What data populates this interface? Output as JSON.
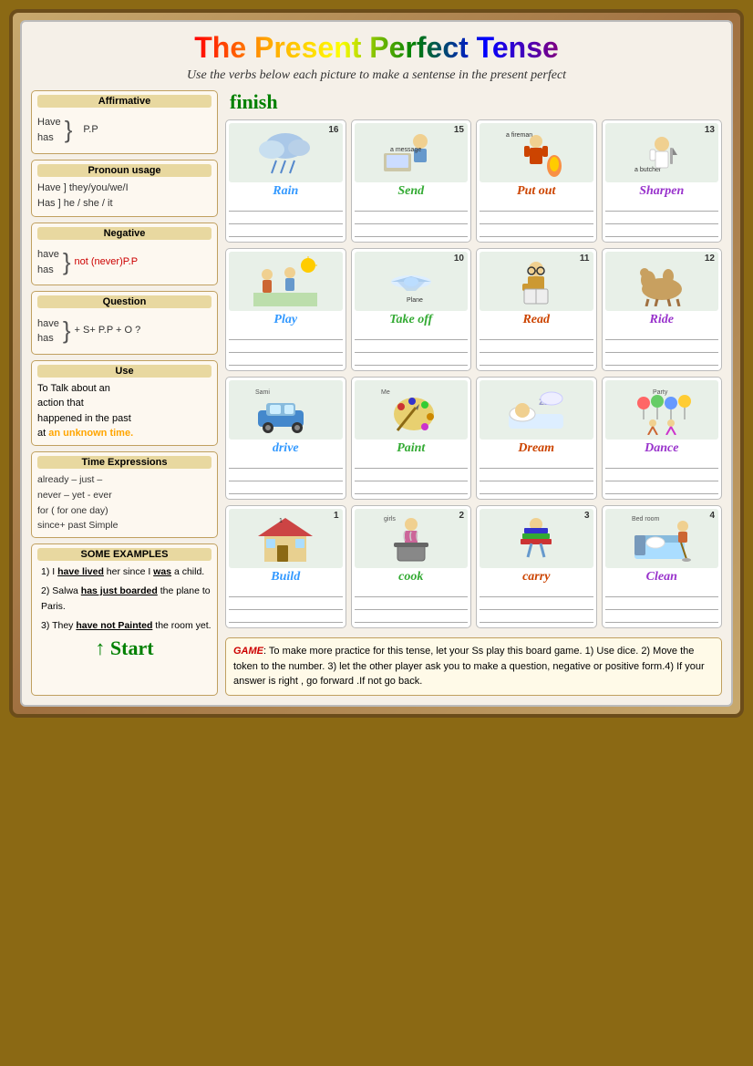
{
  "page": {
    "title": "The Present Perfect Tense",
    "subtitle": "Use the verbs below each picture to make a sentense in the present perfect",
    "background_color": "#8B6914"
  },
  "left_panel": {
    "affirmative": {
      "title": "Affirmative",
      "have": "Have",
      "has": "has",
      "pp": "P.P"
    },
    "pronoun": {
      "title": "Pronoun usage",
      "have_line": "Have ] they/you/we/I",
      "has_line": "Has ] he / she / it"
    },
    "negative": {
      "title": "Negative",
      "have": "have",
      "has": "has",
      "not_label": "not (never)P.P"
    },
    "question": {
      "title": "Question",
      "have": "have",
      "has": "has",
      "formula": "+ S+ P.P + O ?"
    },
    "use": {
      "title": "Use",
      "line1": "To Talk about an",
      "line2": "action that",
      "line3": "happened in the past",
      "line4": "at ",
      "unknown": "an unknown time."
    },
    "time_expressions": {
      "title": "Time Expressions",
      "line1": "already – just –",
      "line2": "never – yet - ever",
      "line3": "for ( for one day)",
      "line4": "since+ past Simple"
    },
    "examples": {
      "title": "SOME EXAMPLES",
      "ex1_pre": "I ",
      "ex1_verb": "have lived",
      "ex1_mid": " her since I ",
      "ex1_verb2": "was",
      "ex1_end": " a child.",
      "ex2_pre": "Salwa ",
      "ex2_verb": "has just boarded",
      "ex2_end": " the plane to Paris.",
      "ex3_pre": "They ",
      "ex3_verb": "have not Painted",
      "ex3_end": " the room yet."
    },
    "start_label": "↑ Start"
  },
  "grid": {
    "finish_label": "finish",
    "rows": [
      [
        {
          "label": "Rain",
          "color": "rain",
          "number": "16",
          "img": "rain"
        },
        {
          "label": "Send",
          "color": "send",
          "number": "15",
          "img": "send"
        },
        {
          "label": "Put out",
          "color": "putout",
          "number": "",
          "img": "putout"
        },
        {
          "label": "Sharpen",
          "color": "sharpen",
          "number": "13",
          "img": "sharpen"
        }
      ],
      [
        {
          "label": "Play",
          "color": "play",
          "number": "",
          "img": "play"
        },
        {
          "label": "Take off",
          "color": "takeoff",
          "number": "10",
          "img": "takeoff"
        },
        {
          "label": "Read",
          "color": "read",
          "number": "11",
          "img": "read"
        },
        {
          "label": "Ride",
          "color": "ride",
          "number": "12",
          "img": "ride"
        }
      ],
      [
        {
          "label": "drive",
          "color": "drive",
          "number": "",
          "img": "drive"
        },
        {
          "label": "Paint",
          "color": "paint",
          "number": "",
          "img": "paint"
        },
        {
          "label": "Dream",
          "color": "dream",
          "number": "",
          "img": "dream"
        },
        {
          "label": "Dance",
          "color": "dance",
          "number": "",
          "img": "dance"
        }
      ],
      [
        {
          "label": "Build",
          "color": "build",
          "number": "1",
          "img": "build"
        },
        {
          "label": "cook",
          "color": "cook",
          "number": "2",
          "img": "cook"
        },
        {
          "label": "carry",
          "color": "carry",
          "number": "3",
          "img": "carry"
        },
        {
          "label": "Clean",
          "color": "clean",
          "number": "4",
          "img": "clean"
        }
      ]
    ]
  },
  "game": {
    "label": "GAME",
    "text": ": To make more practice for this tense, let your Ss play this board game. 1) Use dice. 2) Move the token to the number. 3) let the other player ask you to make a question, negative or positive form.4) If your answer is right , go forward .If not go back."
  }
}
